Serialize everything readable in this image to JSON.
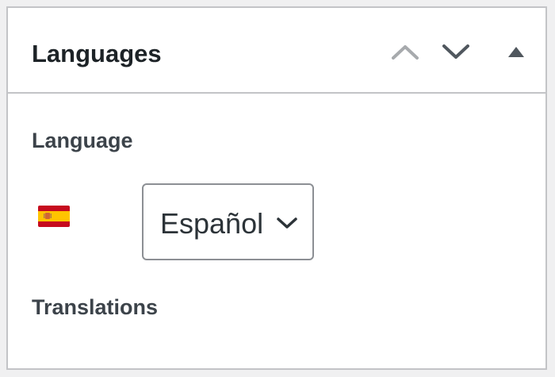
{
  "panel": {
    "title": "Languages"
  },
  "language": {
    "label": "Language",
    "selected": "Español",
    "flag": "spain-flag"
  },
  "translations": {
    "label": "Translations"
  },
  "icons": {
    "move_up": "chevron-up-icon",
    "move_down": "chevron-down-icon",
    "toggle": "triangle-up-icon",
    "select": "chevron-down-icon"
  },
  "colors": {
    "border": "#c3c4c7",
    "title": "#1d2327",
    "label": "#3c434a",
    "icon_disabled": "#a7aaad",
    "icon_active": "#50575e",
    "select_border": "#8c8f94",
    "flag_red": "#c60b1e",
    "flag_yellow": "#ffc400"
  }
}
